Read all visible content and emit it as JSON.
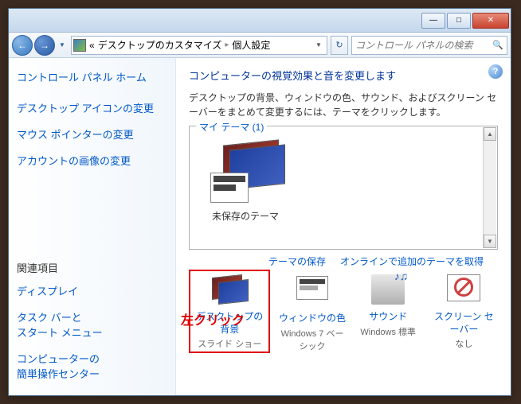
{
  "titlebar": {
    "min": "—",
    "max": "□",
    "close": "✕"
  },
  "nav": {
    "breadcrumb_sep": "«",
    "breadcrumb1": "デスクトップのカスタマイズ",
    "crumb_sep": "▸",
    "breadcrumb2": "個人設定",
    "search_placeholder": "コントロール パネルの検索"
  },
  "sidebar": {
    "links": [
      "コントロール パネル ホーム",
      "デスクトップ アイコンの変更",
      "マウス ポインターの変更",
      "アカウントの画像の変更"
    ],
    "related_heading": "関連項目",
    "related": [
      "ディスプレイ",
      "タスク バーと\nスタート メニュー",
      "コンピューターの\n簡単操作センター"
    ]
  },
  "main": {
    "title": "コンピューターの視覚効果と音を変更します",
    "desc": "デスクトップの背景、ウィンドウの色、サウンド、およびスクリーン セーバーをまとめて変更するには、テーマをクリックします。",
    "theme_group": "マイ テーマ (1)",
    "theme_name": "未保存のテーマ",
    "save_theme": "テーマの保存",
    "online_themes": "オンラインで追加のテーマを取得",
    "annotation": "左クリック",
    "items": [
      {
        "label": "デスクトップの背景",
        "sub": "スライド ショー"
      },
      {
        "label": "ウィンドウの色",
        "sub": "Windows 7 ベーシック"
      },
      {
        "label": "サウンド",
        "sub": "Windows 標準"
      },
      {
        "label": "スクリーン セーバー",
        "sub": "なし"
      }
    ]
  }
}
